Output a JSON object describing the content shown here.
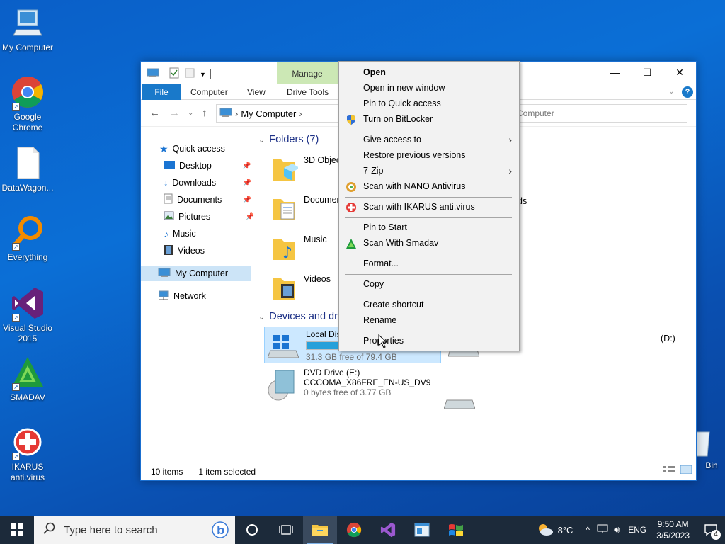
{
  "desktop": {
    "icons": [
      {
        "label": "My Computer"
      },
      {
        "label": "Google Chrome"
      },
      {
        "label": "DataWagon..."
      },
      {
        "label": "Everything"
      },
      {
        "label": "Visual Studio 2015"
      },
      {
        "label": "SMADAV"
      },
      {
        "label": "IKARUS anti.virus"
      },
      {
        "label": "Bin"
      }
    ]
  },
  "explorer": {
    "manage_label": "Manage",
    "tabs": [
      "File",
      "Computer",
      "View",
      "Drive Tools"
    ],
    "address": "My Computer",
    "search_placeholder": "Computer",
    "nav": {
      "quick_access": "Quick access",
      "items": [
        "Desktop",
        "Downloads",
        "Documents",
        "Pictures",
        "Music",
        "Videos"
      ],
      "my_computer": "My Computer",
      "network": "Network"
    },
    "folders_header": "Folders (7)",
    "folders": [
      "3D Objec",
      "Documer",
      "Music",
      "Videos"
    ],
    "folder_right_partial": "ds",
    "devices_header": "Devices and dr",
    "drives": {
      "local": {
        "name": "Local Dis",
        "free": "31.3 GB free of 79.4 GB",
        "used_fraction": 0.61
      },
      "d_partial": "(D:)",
      "dvd": {
        "name": "DVD Drive (E:)",
        "label": "CCCOMA_X86FRE_EN-US_DV9",
        "free": "0 bytes free of 3.77 GB"
      }
    },
    "status": {
      "items": "10 items",
      "selected": "1 item selected"
    }
  },
  "context_menu": {
    "items": [
      "Open",
      "Open in new window",
      "Pin to Quick access",
      "Turn on BitLocker",
      "Give access to",
      "Restore previous versions",
      "7-Zip",
      "Scan with NANO Antivirus",
      "Scan with IKARUS anti.virus",
      "Pin to Start",
      "Scan With Smadav",
      "Format...",
      "Copy",
      "Create shortcut",
      "Rename",
      "Properties"
    ]
  },
  "taskbar": {
    "search_placeholder": "Type here to search",
    "weather": "8°C",
    "lang": "ENG",
    "time": "9:50 AM",
    "date": "3/5/2023",
    "notifications": "4"
  }
}
